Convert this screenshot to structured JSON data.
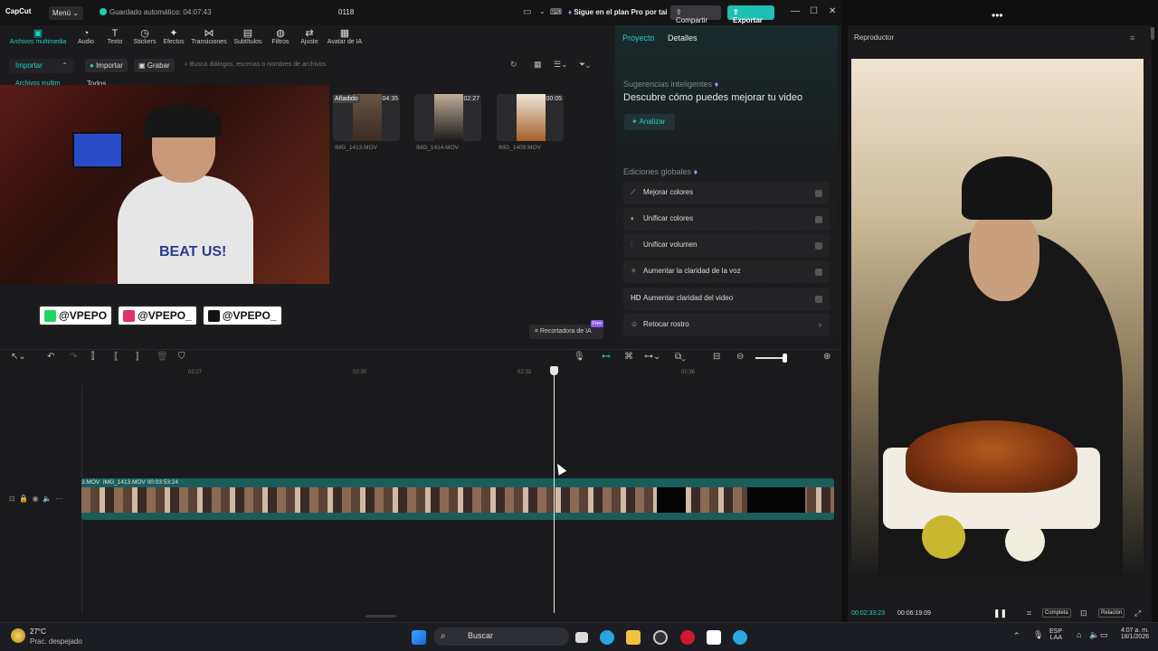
{
  "app": {
    "logo": "CapCut",
    "menu": "Menú",
    "autosave": "Guardado automático: 04:07:43",
    "project_title": "0118",
    "pro_text": "Sigue en el plan Pro por tai",
    "share": "Compartir",
    "export": "Exportar"
  },
  "toolbar": {
    "items": [
      {
        "label": "Archivos multimedia",
        "icon": "media-icon"
      },
      {
        "label": "Audio",
        "icon": "audio-icon"
      },
      {
        "label": "Texto",
        "icon": "text-icon"
      },
      {
        "label": "Stickers",
        "icon": "sticker-icon"
      },
      {
        "label": "Efectos",
        "icon": "effects-icon"
      },
      {
        "label": "Transiciones",
        "icon": "transition-icon"
      },
      {
        "label": "Subtítulos",
        "icon": "subtitle-icon"
      },
      {
        "label": "Filtros",
        "icon": "filter-icon"
      },
      {
        "label": "Ajuste",
        "icon": "adjust-icon"
      },
      {
        "label": "Avatar de IA",
        "icon": "avatar-icon"
      }
    ]
  },
  "media": {
    "import_dropdown": "Importar",
    "import_chip": "Importar",
    "record_chip": "Grabar",
    "search_placeholder": "Busca diálogos, escenas o nombres de archivos",
    "sidebar_label": "Archivos multim",
    "filter_all": "Todos",
    "files": [
      {
        "name": "IMG_1413.MOV",
        "duration": "04:35",
        "badge": "Añadido"
      },
      {
        "name": "IMG_1414.MOV",
        "duration": "02:27",
        "badge": ""
      },
      {
        "name": "IMG_1409.MOV",
        "duration": "00:05",
        "badge": ""
      }
    ],
    "recorder": "Recortadora de IA",
    "recorder_badge": "Free"
  },
  "overlay": {
    "shirt_text": "BEAT US!",
    "socials": [
      {
        "handle": "@VPEPO",
        "color": "#1ed760"
      },
      {
        "handle": "@VPEPO_",
        "color": "#e1306c"
      },
      {
        "handle": "@VPEPO_",
        "color": "#111111"
      }
    ]
  },
  "right_panel": {
    "tab_project": "Proyecto",
    "tab_details": "Detalles",
    "smart_heading": "Sugerencias inteligentes",
    "smart_sub": "Descubre cómo puedes mejorar tu video",
    "analyze": "Analizar",
    "global_heading": "Ediciones globales",
    "options": [
      {
        "label": "Mejorar colores",
        "icon": "wand-icon",
        "kind": "toggle"
      },
      {
        "label": "Unificar colores",
        "icon": "palette-icon",
        "kind": "toggle"
      },
      {
        "label": "Unificar volumen",
        "icon": "sliders-icon",
        "kind": "toggle"
      },
      {
        "label": "Aumentar la claridad de la voz",
        "icon": "voice-icon",
        "kind": "toggle"
      },
      {
        "label": "Aumentar claridad del video",
        "icon": "hd-icon",
        "kind": "toggle"
      },
      {
        "label": "Retocar rostro",
        "icon": "face-icon",
        "kind": "chevron"
      }
    ]
  },
  "timeline": {
    "ruler": [
      "02:27",
      "02:30",
      "02:33",
      "02:36"
    ],
    "clip_label_a": "3.MOV",
    "clip_label_b": "IMG_1413.MOV  00:03:53:24"
  },
  "viewer": {
    "title": "Reproductor",
    "current_time": "00:02:33:23",
    "total_time": "00:06:19:09",
    "full_label": "Completa",
    "ratio_label": "Relación"
  },
  "taskbar": {
    "temp": "27°C",
    "weather": "Prac. despejado",
    "search": "Buscar",
    "lang": "ESP",
    "region": "LAA",
    "time": "4:07 a. m.",
    "date": "18/1/2026"
  }
}
